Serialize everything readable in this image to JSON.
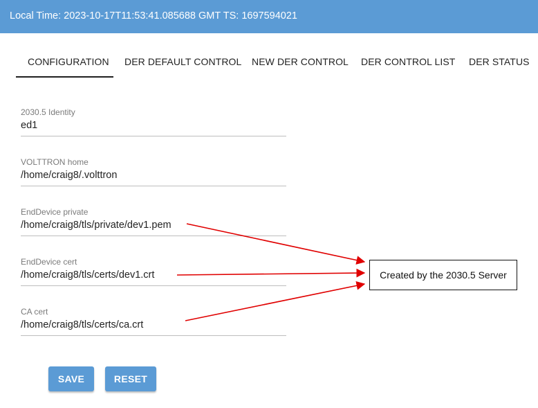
{
  "header": {
    "title": "Local Time: 2023-10-17T11:53:41.085688 GMT TS: 1697594021"
  },
  "tabs": [
    {
      "label": "CONFIGURATION",
      "active": true
    },
    {
      "label": "DER DEFAULT CONTROL",
      "active": false
    },
    {
      "label": "NEW DER CONTROL",
      "active": false
    },
    {
      "label": "DER CONTROL LIST",
      "active": false
    },
    {
      "label": "DER STATUS",
      "active": false
    }
  ],
  "form": {
    "fields": [
      {
        "label": "2030.5 Identity",
        "value": "ed1"
      },
      {
        "label": "VOLTTRON home",
        "value": "/home/craig8/.volttron"
      },
      {
        "label": "EndDevice private",
        "value": "/home/craig8/tls/private/dev1.pem"
      },
      {
        "label": "EndDevice cert",
        "value": "/home/craig8/tls/certs/dev1.crt"
      },
      {
        "label": "CA cert",
        "value": "/home/craig8/tls/certs/ca.crt"
      }
    ],
    "save_label": "SAVE",
    "reset_label": "RESET"
  },
  "annotation": {
    "callout_text": "Created by the 2030.5 Server",
    "arrow_color": "#e00000"
  },
  "colors": {
    "accent": "#5b9bd5"
  }
}
